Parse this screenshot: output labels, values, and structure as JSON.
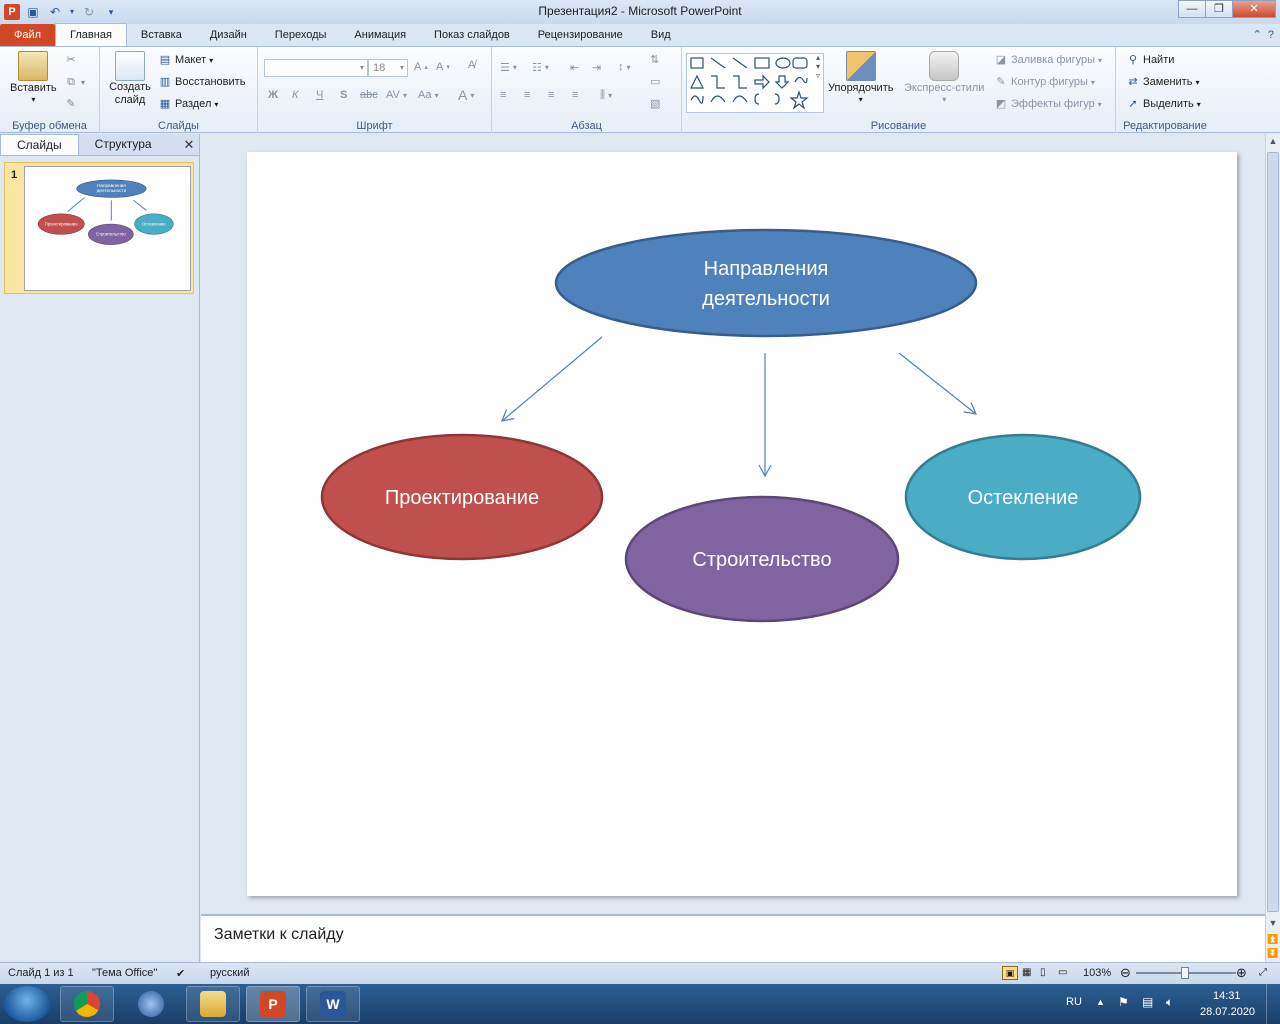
{
  "window": {
    "title": "Презентация2 - Microsoft PowerPoint"
  },
  "tabs": [
    {
      "label": "Файл"
    },
    {
      "label": "Главная"
    },
    {
      "label": "Вставка"
    },
    {
      "label": "Дизайн"
    },
    {
      "label": "Переходы"
    },
    {
      "label": "Анимация"
    },
    {
      "label": "Показ слайдов"
    },
    {
      "label": "Рецензирование"
    },
    {
      "label": "Вид"
    }
  ],
  "ribbon": {
    "clipboard": {
      "paste": "Вставить",
      "label": "Буфер обмена"
    },
    "slides": {
      "new_slide": "Создать слайд",
      "layout": "Макет",
      "reset": "Восстановить",
      "section": "Раздел",
      "label": "Слайды"
    },
    "font": {
      "size": "18",
      "label": "Шрифт",
      "bold": "Ж",
      "italic": "К",
      "underline": "Ч",
      "strike": "S",
      "abc": "abc",
      "spacing": "AV",
      "case": "Aa",
      "color": "A"
    },
    "paragraph": {
      "label": "Абзац"
    },
    "drawing": {
      "arrange": "Упорядочить",
      "quick_styles": "Экспресс-стили",
      "fill": "Заливка фигуры",
      "outline": "Контур фигуры",
      "effects": "Эффекты фигур",
      "label": "Рисование"
    },
    "editing": {
      "find": "Найти",
      "replace": "Заменить",
      "select": "Выделить",
      "label": "Редактирование"
    }
  },
  "left_panel": {
    "tab_slides": "Слайды",
    "tab_outline": "Структура",
    "close": "✕",
    "slide_number": "1"
  },
  "slide": {
    "top_node": "Направления деятельности",
    "top_line1": "Направления",
    "top_line2": "деятельности",
    "node_left": "Проектирование",
    "node_middle": "Строительство",
    "node_right": "Остекление",
    "colors": {
      "top": "#4f81bd",
      "left": "#c0504d",
      "middle": "#8064a2",
      "right": "#4bacc6",
      "arrow": "#4f81bd"
    }
  },
  "notes": {
    "placeholder": "Заметки к слайду"
  },
  "status": {
    "slide_of": "Слайд 1 из 1",
    "theme": "\"Тема Office\"",
    "language": "русский",
    "zoom": "103%"
  },
  "taskbar": {
    "lang": "RU",
    "time": "14:31",
    "date": "28.07.2020"
  }
}
